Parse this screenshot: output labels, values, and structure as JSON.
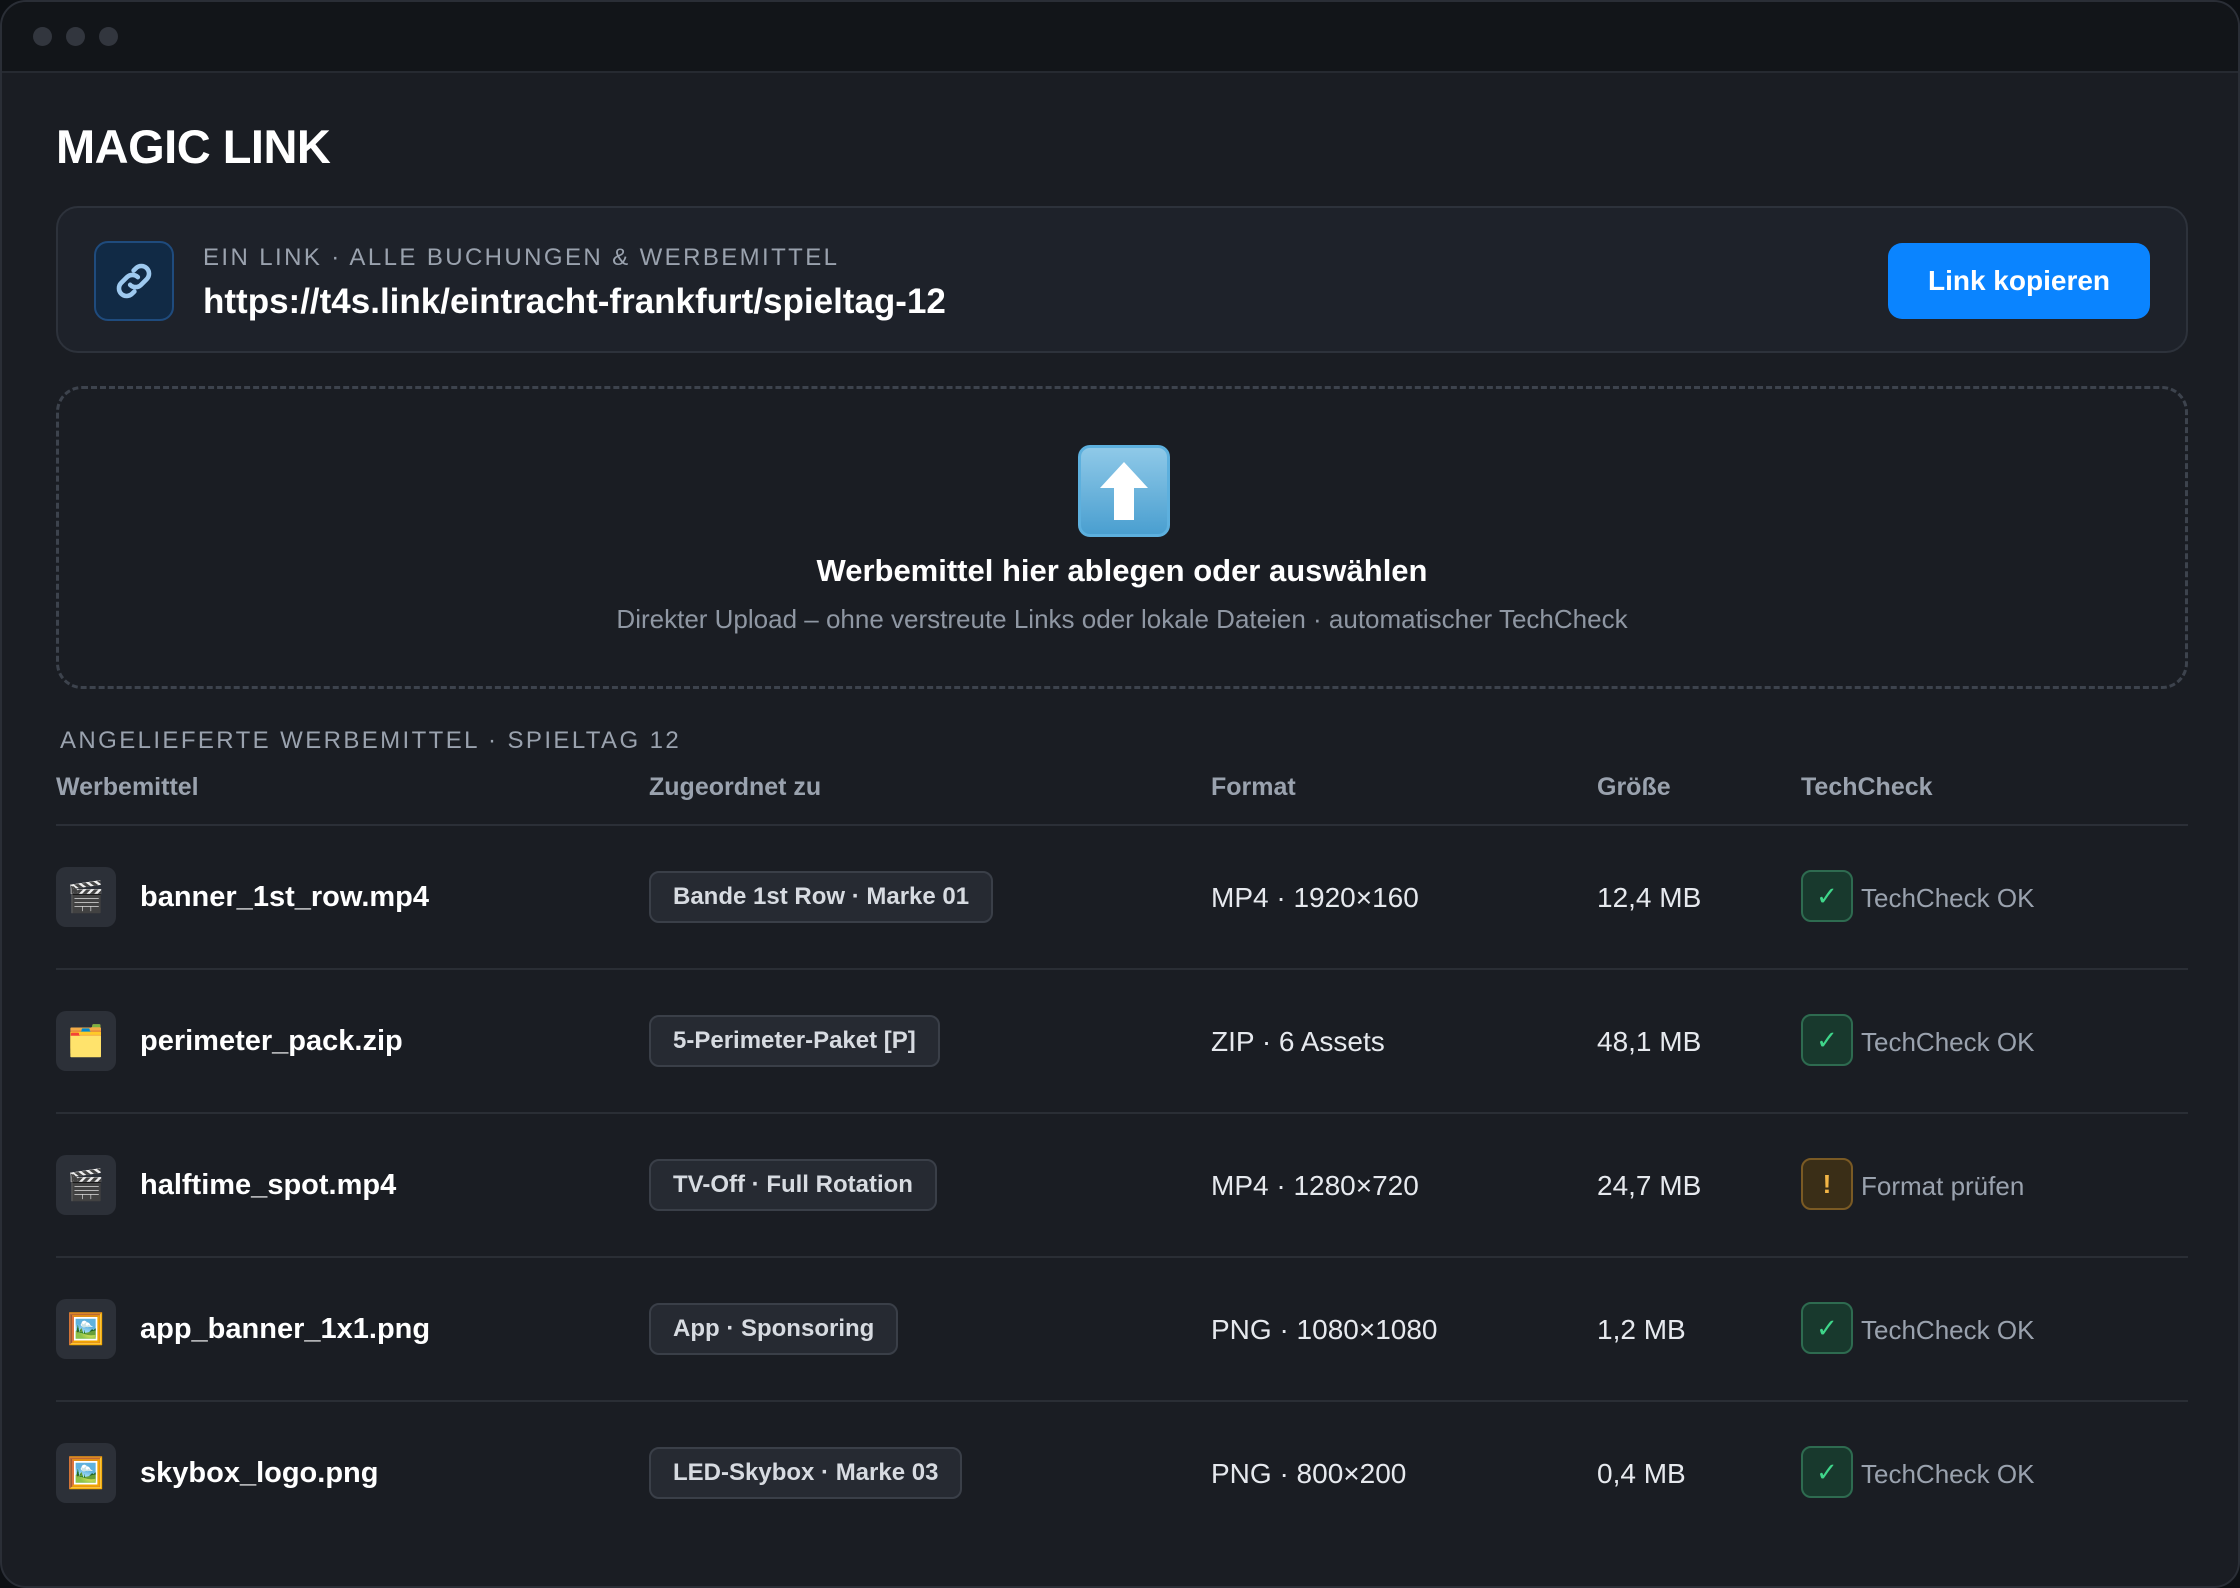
{
  "window": {
    "title": "MAGIC LINK"
  },
  "link": {
    "caption": "EIN LINK · ALLE BUCHUNGEN & WERBEMITTEL",
    "url": "https://t4s.link/eintracht-frankfurt/spieltag-12",
    "icon": "link-icon",
    "copy_label": "Link kopieren"
  },
  "dropzone": {
    "icon": "upload-arrow-icon",
    "title": "Werbemittel hier ablegen oder auswählen",
    "subtitle": "Direkter Upload – ohne verstreute Links oder lokale Dateien · automatischer TechCheck"
  },
  "section": {
    "label": "ANGELIEFERTE WERBEMITTEL · SPIELTAG 12"
  },
  "table": {
    "headers": [
      "Werbemittel",
      "Zugeordnet zu",
      "Format",
      "Größe",
      "TechCheck"
    ],
    "rows": [
      {
        "icon": "video-clapper-icon",
        "glyph": "🎬",
        "name": "banner_1st_row.mp4",
        "assigned": "Bande 1st Row · Marke 01",
        "format": "MP4 · 1920×160",
        "size": "12,4 MB",
        "status": "ok",
        "status_glyph": "✓",
        "status_label": "TechCheck OK"
      },
      {
        "icon": "folder-icon",
        "glyph": "🗂️",
        "name": "perimeter_pack.zip",
        "assigned": "5-Perimeter-Paket [P]",
        "format": "ZIP · 6 Assets",
        "size": "48,1 MB",
        "status": "ok",
        "status_glyph": "✓",
        "status_label": "TechCheck OK"
      },
      {
        "icon": "video-clapper-icon",
        "glyph": "🎬",
        "name": "halftime_spot.mp4",
        "assigned": "TV-Off · Full Rotation",
        "format": "MP4 · 1280×720",
        "size": "24,7 MB",
        "status": "warn",
        "status_glyph": "!",
        "status_label": "Format prüfen"
      },
      {
        "icon": "image-icon",
        "glyph": "🖼️",
        "name": "app_banner_1x1.png",
        "assigned": "App · Sponsoring",
        "format": "PNG · 1080×1080",
        "size": "1,2 MB",
        "status": "ok",
        "status_glyph": "✓",
        "status_label": "TechCheck OK"
      },
      {
        "icon": "image-icon",
        "glyph": "🖼️",
        "name": "skybox_logo.png",
        "assigned": "LED-Skybox · Marke 03",
        "format": "PNG · 800×200",
        "size": "0,4 MB",
        "status": "ok",
        "status_glyph": "✓",
        "status_label": "TechCheck OK"
      }
    ]
  },
  "colors": {
    "accent": "#0a84ff",
    "ok": "#3fd68a",
    "warn": "#f3b646",
    "background": "#1a1d23"
  }
}
